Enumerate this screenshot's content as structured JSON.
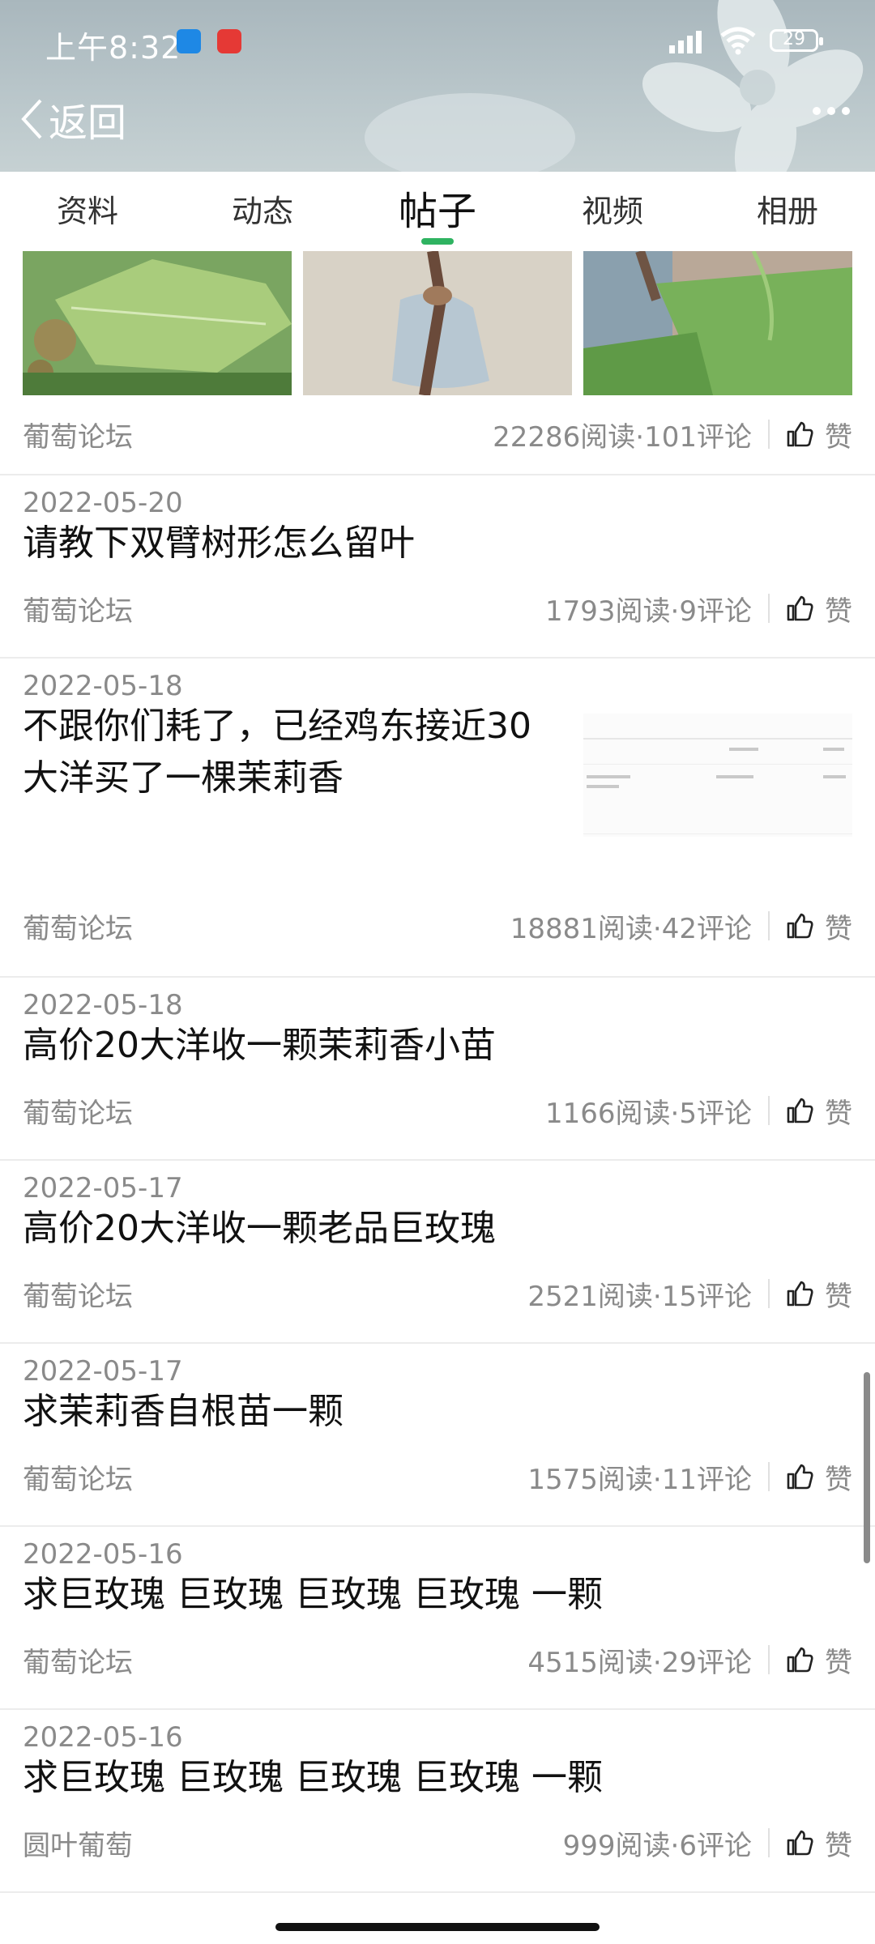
{
  "status_bar": {
    "time": "上午8:32",
    "battery": "29"
  },
  "nav": {
    "back_label": "返回"
  },
  "tabs": [
    {
      "label": "资料"
    },
    {
      "label": "动态"
    },
    {
      "label": "帖子",
      "active": true
    },
    {
      "label": "视频"
    },
    {
      "label": "相册"
    }
  ],
  "posts": [
    {
      "forum": "葡萄论坛",
      "stats": "22286阅读·101评论",
      "like": "赞"
    },
    {
      "date": "2022-05-20",
      "title": "请教下双臂树形怎么留叶",
      "forum": "葡萄论坛",
      "stats": "1793阅读·9评论",
      "like": "赞"
    },
    {
      "date": "2022-05-18",
      "title_line1": "不跟你们耗了，已经鸡东接近30",
      "title_line2": "大洋买了一棵茉莉香",
      "forum": "葡萄论坛",
      "stats": "18881阅读·42评论",
      "like": "赞"
    },
    {
      "date": "2022-05-18",
      "title": "高价20大洋收一颗茉莉香小苗",
      "forum": "葡萄论坛",
      "stats": "1166阅读·5评论",
      "like": "赞"
    },
    {
      "date": "2022-05-17",
      "title": "高价20大洋收一颗老品巨玫瑰",
      "forum": "葡萄论坛",
      "stats": "2521阅读·15评论",
      "like": "赞"
    },
    {
      "date": "2022-05-17",
      "title": "求茉莉香自根苗一颗",
      "forum": "葡萄论坛",
      "stats": "1575阅读·11评论",
      "like": "赞"
    },
    {
      "date": "2022-05-16",
      "title": "求巨玫瑰 巨玫瑰 巨玫瑰 巨玫瑰 一颗",
      "forum": "葡萄论坛",
      "stats": "4515阅读·29评论",
      "like": "赞"
    },
    {
      "date": "2022-05-16",
      "title": "求巨玫瑰 巨玫瑰 巨玫瑰 巨玫瑰 一颗",
      "forum": "圆叶葡萄",
      "stats": "999阅读·6评论",
      "like": "赞"
    }
  ],
  "colors": {
    "accent": "#2fb361",
    "meta_text": "#8a8a8a"
  }
}
